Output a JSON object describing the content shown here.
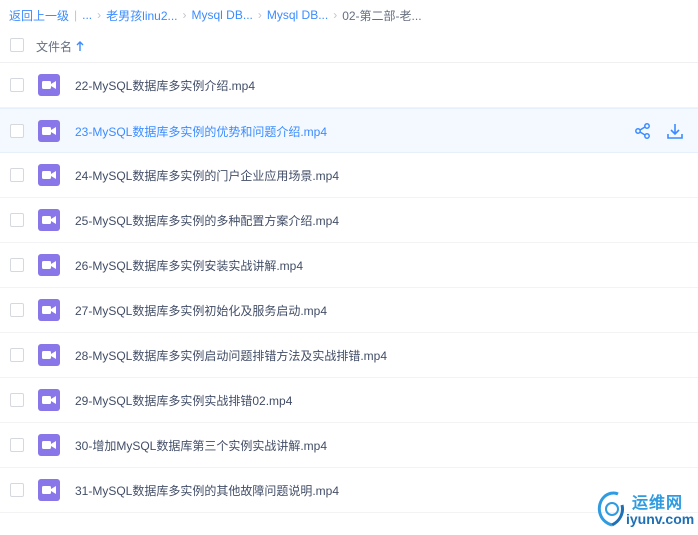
{
  "breadcrumb": {
    "back": "返回上一级",
    "ellipsis": "...",
    "items": [
      "老男孩linu2...",
      "Mysql DB...",
      "Mysql DB..."
    ],
    "current": "02-第二部-老..."
  },
  "header": {
    "column_label": "文件名",
    "sort_icon": "arrow-up-icon"
  },
  "files": [
    {
      "name": "22-MySQL数据库多实例介绍.mp4",
      "icon": "video-file-icon"
    },
    {
      "name": "23-MySQL数据库多实例的优势和问题介绍.mp4",
      "icon": "video-file-icon"
    },
    {
      "name": "24-MySQL数据库多实例的门户企业应用场景.mp4",
      "icon": "video-file-icon"
    },
    {
      "name": "25-MySQL数据库多实例的多种配置方案介绍.mp4",
      "icon": "video-file-icon"
    },
    {
      "name": "26-MySQL数据库多实例安装实战讲解.mp4",
      "icon": "video-file-icon"
    },
    {
      "name": "27-MySQL数据库多实例初始化及服务启动.mp4",
      "icon": "video-file-icon"
    },
    {
      "name": "28-MySQL数据库多实例启动问题排错方法及实战排错.mp4",
      "icon": "video-file-icon"
    },
    {
      "name": "29-MySQL数据库多实例实战排错02.mp4",
      "icon": "video-file-icon"
    },
    {
      "name": "30-增加MySQL数据库第三个实例实战讲解.mp4",
      "icon": "video-file-icon"
    },
    {
      "name": "31-MySQL数据库多实例的其他故障问题说明.mp4",
      "icon": "video-file-icon"
    }
  ],
  "hover_actions": {
    "share_icon": "share-icon",
    "download_icon": "download-icon"
  },
  "watermark": {
    "cn": "运维网",
    "en": "iyunv.com"
  },
  "colors": {
    "accent": "#3b8cff",
    "video_icon": "#8976e8",
    "hover_row": "#f4f9ff"
  }
}
